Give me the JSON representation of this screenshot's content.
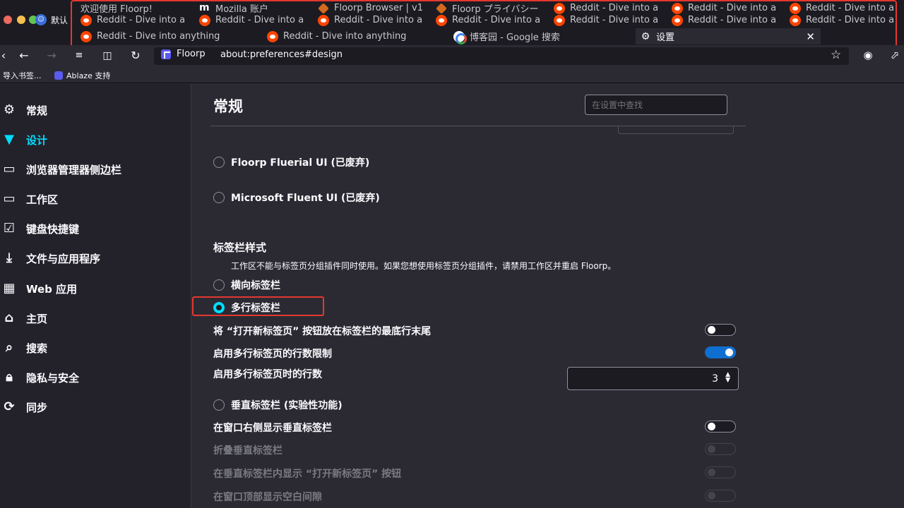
{
  "window": {
    "welcome_tab": "欢迎使用 Floorp!",
    "firefox_account_label": "默认",
    "tab_rows": [
      [
        {
          "title": "欢迎使用 Floorp!",
          "icon": "floorp-icon"
        },
        {
          "title": "Mozilla 账户",
          "icon": "mozilla-icon"
        },
        {
          "title": "Floorp Browser | v1",
          "icon": "floorp-icon"
        },
        {
          "title": "Floorp プライバシー",
          "icon": "floorp-icon"
        },
        {
          "title": "Reddit - Dive into a",
          "icon": "reddit-icon"
        },
        {
          "title": "Reddit - Dive into a",
          "icon": "reddit-icon"
        },
        {
          "title": "Reddit - Dive into a",
          "icon": "reddit-icon"
        }
      ],
      [
        {
          "title": "Reddit - Dive into a",
          "icon": "reddit-icon"
        },
        {
          "title": "Reddit - Dive into a",
          "icon": "reddit-icon"
        },
        {
          "title": "Reddit - Dive into a",
          "icon": "reddit-icon"
        },
        {
          "title": "Reddit - Dive into a",
          "icon": "reddit-icon"
        },
        {
          "title": "Reddit - Dive into a",
          "icon": "reddit-icon"
        },
        {
          "title": "Reddit - Dive into a",
          "icon": "reddit-icon"
        },
        {
          "title": "Reddit - Dive into a",
          "icon": "reddit-icon"
        }
      ],
      [
        {
          "title": "Reddit - Dive into anything",
          "icon": "reddit-icon"
        },
        {
          "title": "Reddit - Dive into anything",
          "icon": "reddit-icon"
        },
        {
          "title": "博客园 - Google 搜索",
          "icon": "google-icon"
        },
        {
          "title": "设置",
          "icon": "gear-icon",
          "active": true
        }
      ]
    ],
    "close_glyph": "✕"
  },
  "navbar": {
    "identity_label": "Floorp",
    "url": "about:preferences#design"
  },
  "bookmarks": {
    "items": [
      "导入书签...",
      "Ablaze 支持"
    ]
  },
  "sidebar": {
    "items": [
      {
        "label": "常规",
        "icon": "gear-icon"
      },
      {
        "label": "设计",
        "icon": "paintbrush-icon",
        "selected": true
      },
      {
        "label": "浏览器管理器侧边栏",
        "icon": "sidebar-icon"
      },
      {
        "label": "工作区",
        "icon": "workspace-icon"
      },
      {
        "label": "键盘快捷键",
        "icon": "keyboard-icon"
      },
      {
        "label": "文件与应用程序",
        "icon": "download-icon"
      },
      {
        "label": "Web 应用",
        "icon": "web-app-icon"
      },
      {
        "label": "主页",
        "icon": "home-icon"
      },
      {
        "label": "搜索",
        "icon": "search-icon"
      },
      {
        "label": "隐私与安全",
        "icon": "lock-icon"
      },
      {
        "label": "同步",
        "icon": "sync-icon"
      }
    ]
  },
  "main": {
    "title": "常规",
    "search_placeholder": "在设置中查找",
    "ui_options": [
      {
        "label": "Floorp Fluerial UI (已废弃)",
        "checked": false
      },
      {
        "label": "Microsoft Fluent UI (已废弃)",
        "checked": false
      }
    ],
    "tabbar_section": {
      "title": "标签栏样式",
      "description": "工作区不能与标签页分组插件同时使用。如果您想使用标签页分组插件，请禁用工作区并重启 Floorp。",
      "horizontal": {
        "label": "横向标签栏",
        "checked": false
      },
      "multirow": {
        "label": "多行标签栏",
        "checked": true
      },
      "newtab_at_end": {
        "label": "将 “打开新标签页” 按钮放在标签栏的最底行末尾",
        "on": false
      },
      "limit_rows": {
        "label": "启用多行标签页的行数限制",
        "on": true
      },
      "row_count": {
        "label": "启用多行标签页时的行数",
        "value": "3"
      },
      "vertical": {
        "label": "垂直标签栏 (实验性功能)",
        "checked": false
      },
      "vertical_right": {
        "label": "在窗口右侧显示垂直标签栏",
        "on": false
      },
      "collapse_vertical": {
        "label": "折叠垂直标签栏",
        "on": false,
        "disabled": true
      },
      "vertical_newtab": {
        "label": "在垂直标签栏内显示 “打开新标签页” 按钮",
        "on": false,
        "disabled": true
      },
      "top_gap": {
        "label": "在窗口顶部显示空白间隙",
        "on": false,
        "disabled": true
      }
    }
  }
}
